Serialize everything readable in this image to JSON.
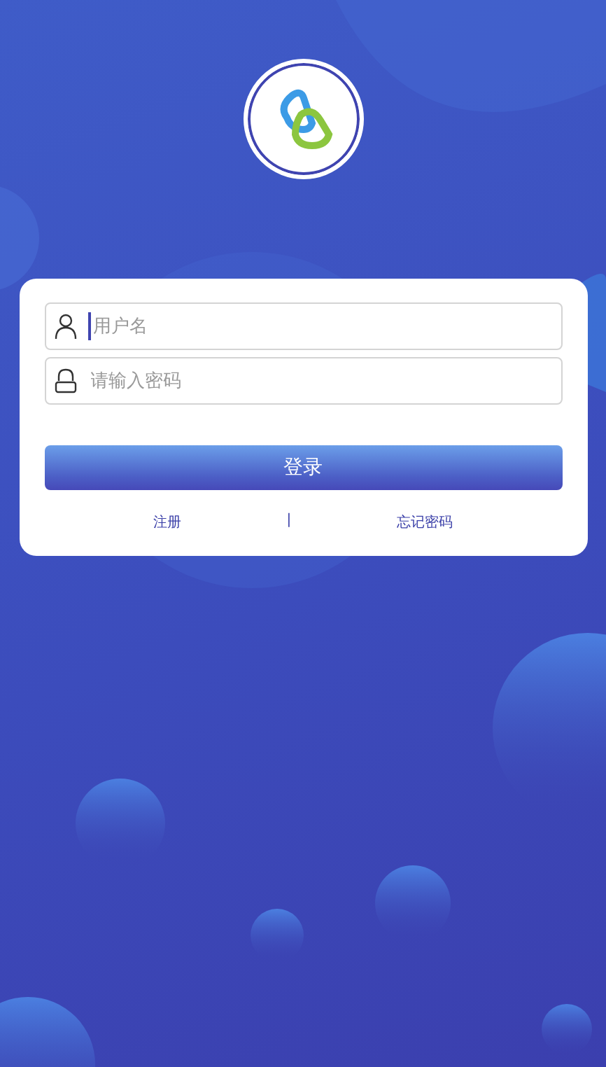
{
  "login_form": {
    "username": {
      "placeholder": "用户名",
      "focused": true
    },
    "password": {
      "placeholder": "请输入密码"
    },
    "submit": {
      "label": "登录"
    },
    "links": [
      {
        "label": "注册"
      },
      {
        "label": "忘记密码"
      }
    ],
    "link_separator": "|"
  }
}
